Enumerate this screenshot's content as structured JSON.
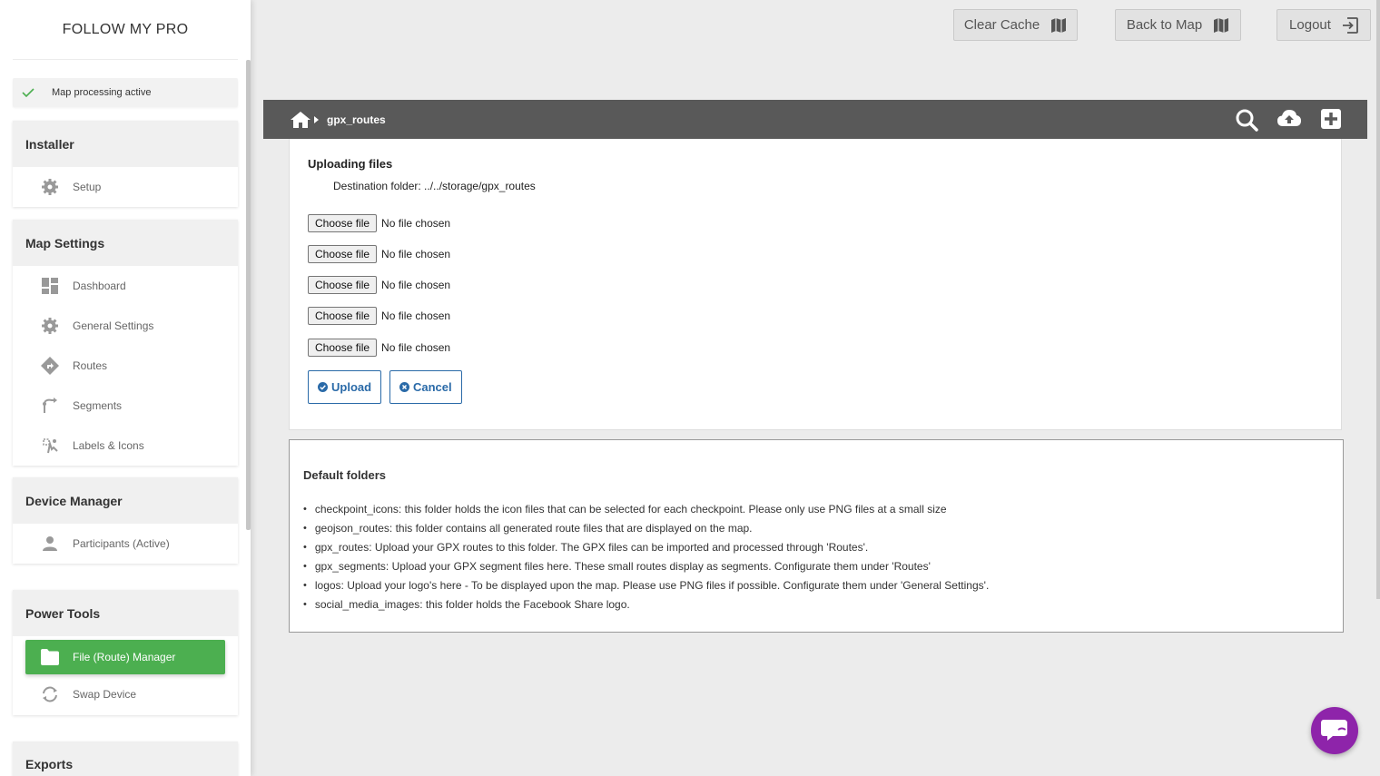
{
  "brand": "FOLLOW MY PRO",
  "status": {
    "text": "Map processing active",
    "icon": "check-icon",
    "color": "#4caf50"
  },
  "sidebar": {
    "installer": {
      "title": "Installer",
      "items": [
        {
          "label": "Setup",
          "icon": "gear-icon"
        }
      ]
    },
    "map_settings": {
      "title": "Map Settings",
      "items": [
        {
          "label": "Dashboard",
          "icon": "dashboard-icon"
        },
        {
          "label": "General Settings",
          "icon": "gear-icon"
        },
        {
          "label": "Routes",
          "icon": "directions-icon"
        },
        {
          "label": "Segments",
          "icon": "segments-icon"
        },
        {
          "label": "Labels & Icons",
          "icon": "labels-icon"
        }
      ]
    },
    "device_manager": {
      "title": "Device Manager",
      "items": [
        {
          "label": "Participants (Active)",
          "icon": "person-icon"
        }
      ]
    },
    "power_tools": {
      "title": "Power Tools",
      "items": [
        {
          "label": "File (Route) Manager",
          "icon": "folder-icon",
          "active": true
        },
        {
          "label": "Swap Device",
          "icon": "swap-icon"
        }
      ]
    },
    "exports": {
      "title": "Exports"
    }
  },
  "topbar": {
    "clear_cache": "Clear Cache",
    "back_to_map": "Back to Map",
    "logout": "Logout"
  },
  "toolbar": {
    "breadcrumb": "gpx_routes"
  },
  "upload": {
    "title": "Uploading files",
    "destination": "Destination folder: ../../storage/gpx_routes",
    "file_inputs": [
      {
        "button": "Choose file",
        "status": "No file chosen"
      },
      {
        "button": "Choose file",
        "status": "No file chosen"
      },
      {
        "button": "Choose file",
        "status": "No file chosen"
      },
      {
        "button": "Choose file",
        "status": "No file chosen"
      },
      {
        "button": "Choose file",
        "status": "No file chosen"
      }
    ],
    "upload_label": "Upload",
    "cancel_label": "Cancel"
  },
  "default_folders": {
    "title": "Default folders",
    "items": [
      "checkpoint_icons: this folder holds the icon files that can be selected for each checkpoint. Please only use PNG files at a small size",
      "geojson_routes: this folder contains all generated route files that are displayed on the map.",
      "gpx_routes: Upload your GPX routes to this folder. The GPX files can be imported and processed through 'Routes'.",
      "gpx_segments: Upload your GPX segment files here. These small routes display as segments. Configurate them under 'Routes'",
      "logos: Upload your logo's here - To be displayed upon the map. Please use PNG files if possible. Configurate them under 'General Settings'.",
      "social_media_images: this folder holds the Facebook Share logo."
    ]
  },
  "colors": {
    "accent": "#4caf50",
    "toolbar": "#595959",
    "link": "#2a6aa8",
    "chat": "#8e24aa"
  }
}
